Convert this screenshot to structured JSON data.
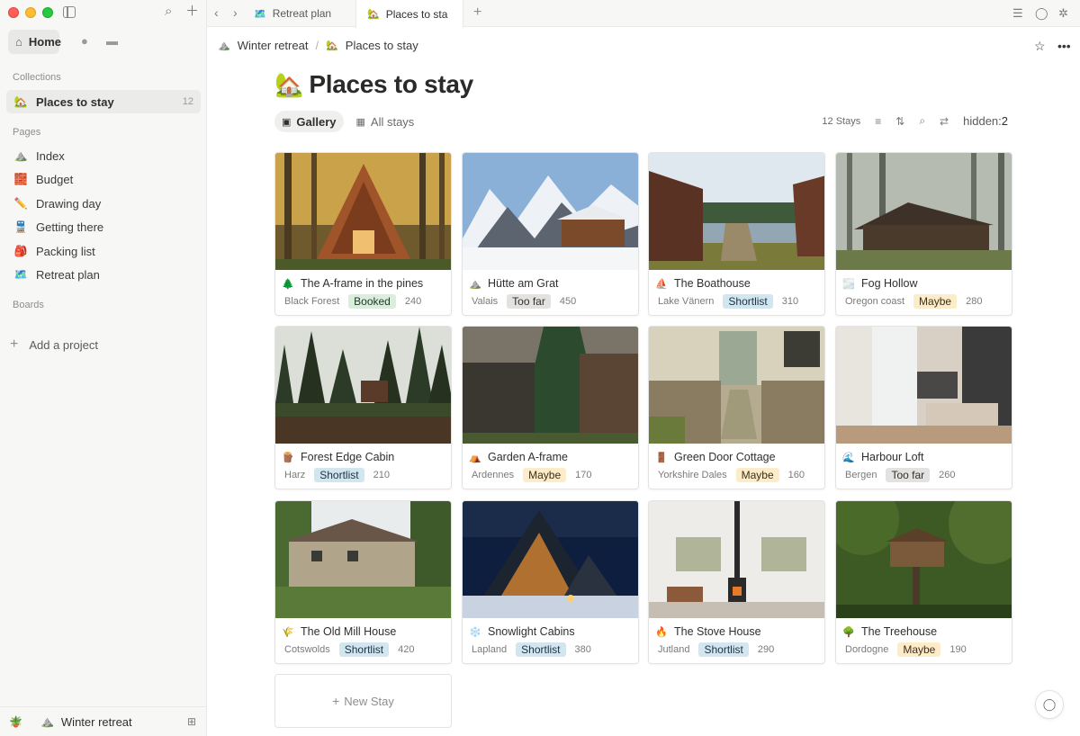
{
  "sidebar": {
    "home_label": "Home",
    "collections_header": "Collections",
    "collections": [
      {
        "icon": "🏡",
        "label": "Places to stay",
        "count": "12"
      }
    ],
    "pages_header": "Pages",
    "pages": [
      {
        "icon": "⛰️",
        "label": "Index"
      },
      {
        "icon": "🧱",
        "label": "Budget"
      },
      {
        "icon": "✏️",
        "label": "Drawing day"
      },
      {
        "icon": "🚆",
        "label": "Getting there"
      },
      {
        "icon": "🎒",
        "label": "Packing list"
      },
      {
        "icon": "🗺️",
        "label": "Retreat plan"
      }
    ],
    "boards_header": "Boards",
    "add_project": "Add a project",
    "workspace_icon": "⛰️",
    "workspace_name": "Winter retreat",
    "avatar_icon": "🪴"
  },
  "tabs": [
    {
      "icon": "🗺️",
      "label": "Retreat plan"
    },
    {
      "icon": "🏡",
      "label": "Places to sta"
    }
  ],
  "breadcrumb": [
    {
      "icon": "⛰️",
      "label": "Winter retreat"
    },
    {
      "icon": "🏡",
      "label": "Places to stay"
    }
  ],
  "page": {
    "icon": "🏡",
    "title": "Places to stay"
  },
  "views": [
    {
      "icon": "▣",
      "label": "Gallery"
    },
    {
      "icon": "▦",
      "label": "All stays"
    }
  ],
  "toolbar": {
    "count_label": "12 Stays",
    "hidden_label": "hidden:",
    "hidden_count": "2"
  },
  "cards": [
    {
      "icon": "🌲",
      "title": "The A-frame in the pines",
      "location": "Black Forest",
      "status": "Booked",
      "status_class": "booked",
      "price": "240",
      "scene": "aframe"
    },
    {
      "icon": "⛰️",
      "title": "Hütte am Grat",
      "location": "Valais",
      "status": "Too far",
      "status_class": "toofar",
      "price": "450",
      "scene": "alps"
    },
    {
      "icon": "⛵",
      "title": "The Boathouse",
      "location": "Lake Vänern",
      "status": "Shortlist",
      "status_class": "shortlist",
      "price": "310",
      "scene": "boathouse"
    },
    {
      "icon": "🌫️",
      "title": "Fog Hollow",
      "location": "Oregon coast",
      "status": "Maybe",
      "status_class": "maybe",
      "price": "280",
      "scene": "fog"
    },
    {
      "icon": "🪵",
      "title": "Forest Edge Cabin",
      "location": "Harz",
      "status": "Shortlist",
      "status_class": "shortlist",
      "price": "210",
      "scene": "forestcabin"
    },
    {
      "icon": "⛺",
      "title": "Garden A-frame",
      "location": "Ardennes",
      "status": "Maybe",
      "status_class": "maybe",
      "price": "170",
      "scene": "garden"
    },
    {
      "icon": "🚪",
      "title": "Green Door Cottage",
      "location": "Yorkshire Dales",
      "status": "Maybe",
      "status_class": "maybe",
      "price": "160",
      "scene": "greendoor"
    },
    {
      "icon": "🌊",
      "title": "Harbour Loft",
      "location": "Bergen",
      "status": "Too far",
      "status_class": "toofar",
      "price": "260",
      "scene": "loft"
    },
    {
      "icon": "🌾",
      "title": "The Old Mill House",
      "location": "Cotswolds",
      "status": "Shortlist",
      "status_class": "shortlist",
      "price": "420",
      "scene": "mill"
    },
    {
      "icon": "❄️",
      "title": "Snowlight Cabins",
      "location": "Lapland",
      "status": "Shortlist",
      "status_class": "shortlist",
      "price": "380",
      "scene": "snow"
    },
    {
      "icon": "🔥",
      "title": "The Stove House",
      "location": "Jutland",
      "status": "Shortlist",
      "status_class": "shortlist",
      "price": "290",
      "scene": "stove"
    },
    {
      "icon": "🌳",
      "title": "The Treehouse",
      "location": "Dordogne",
      "status": "Maybe",
      "status_class": "maybe",
      "price": "190",
      "scene": "tree"
    }
  ],
  "new_card_label": "New Stay",
  "colors": {
    "sidebar_bg": "#f7f7f5",
    "tag_booked": "#dbeddb",
    "tag_toofar": "#e3e2e0",
    "tag_shortlist": "#d3e5ef",
    "tag_maybe": "#fdecc8"
  }
}
